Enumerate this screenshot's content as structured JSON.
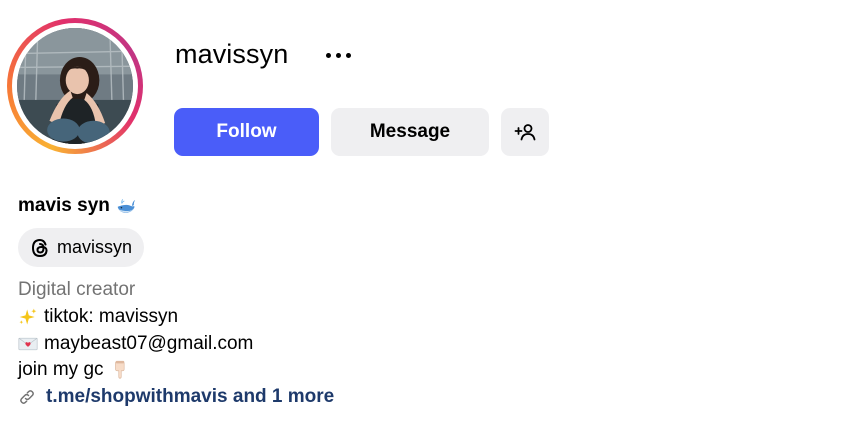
{
  "profile": {
    "username": "mavissyn",
    "display_name": "mavis syn",
    "display_name_emoji": "whale-emoji",
    "avatar": "profile-photo",
    "has_story_ring": true,
    "story_ring_colors": [
      "#f9b233",
      "#f77737",
      "#e1306c",
      "#c13584"
    ]
  },
  "actions": {
    "follow_label": "Follow",
    "message_label": "Message",
    "more_options_icon": "more-horizontal-icon",
    "suggest_icon": "add-person-icon",
    "follow_color": "#4a5df9",
    "secondary_color": "#efeff1"
  },
  "threads": {
    "icon": "threads-icon",
    "handle": "mavissyn"
  },
  "bio": {
    "category": "Digital creator",
    "lines": [
      {
        "emoji": "sparkles-emoji",
        "text": "tiktok: mavissyn"
      },
      {
        "emoji": "love-letter-emoji",
        "text": "maybeast07@gmail.com"
      },
      {
        "text": "join my gc",
        "emoji": "pointing-down-emoji"
      }
    ],
    "link": {
      "icon": "link-icon",
      "text": "t.me/shopwithmavis and 1 more",
      "color": "#1e3a6b"
    }
  }
}
